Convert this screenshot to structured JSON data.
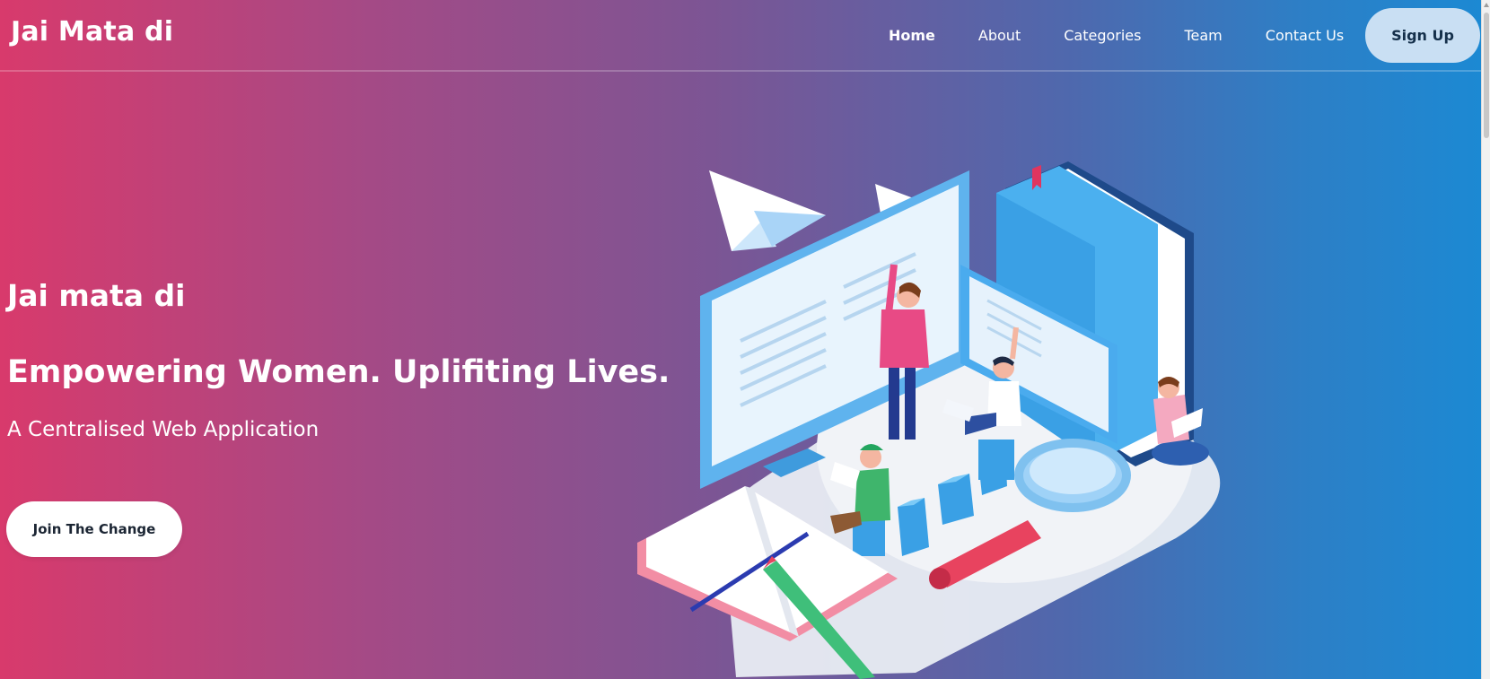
{
  "header": {
    "brand": "Jai Mata di",
    "nav": [
      {
        "label": "Home",
        "active": true
      },
      {
        "label": "About",
        "active": false
      },
      {
        "label": "Categories",
        "active": false
      },
      {
        "label": "Team",
        "active": false
      },
      {
        "label": "Contact Us",
        "active": false
      }
    ],
    "signup_label": "Sign Up"
  },
  "hero": {
    "title": "Jai mata di",
    "heading": "Empowering Women. Uplifiting Lives.",
    "subheading": "A Centralised Web Application",
    "cta_label": "Join The Change"
  },
  "icons": {
    "illustration": "education-isometric-illustration"
  },
  "colors": {
    "gradient_start": "#d83a6c",
    "gradient_end": "#1c89d3",
    "signup_bg": "#c9dff3",
    "cta_bg": "#ffffff"
  }
}
